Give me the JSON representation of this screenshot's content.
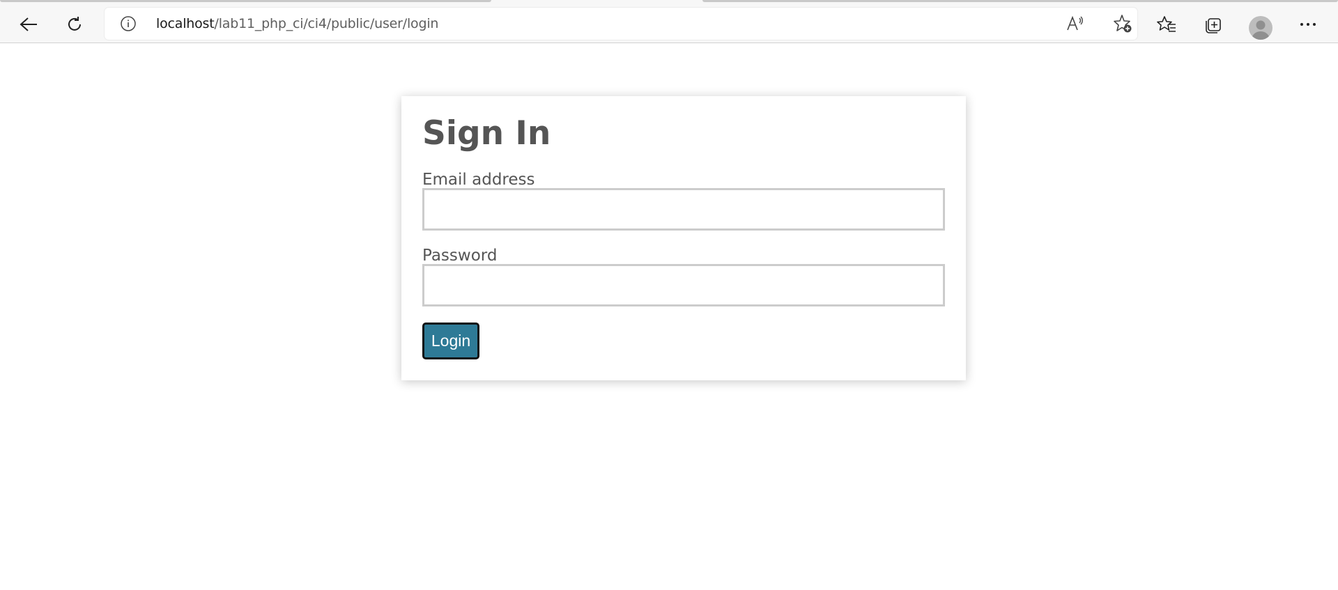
{
  "browser": {
    "address": {
      "host": "localhost",
      "path": "/lab11_php_ci/ci4/public/user/login"
    },
    "icons": {
      "back": "back-arrow-icon",
      "refresh": "refresh-icon",
      "site_info": "info-icon",
      "read_aloud": "read-aloud-icon",
      "add_favorite": "add-favorite-icon",
      "favorites": "favorites-icon",
      "collections": "collections-icon",
      "profile": "profile-avatar",
      "menu": "more-menu-icon"
    }
  },
  "login": {
    "title": "Sign In",
    "email_label": "Email address",
    "email_value": "",
    "password_label": "Password",
    "password_value": "",
    "submit_label": "Login"
  },
  "colors": {
    "button": "#2e7a96",
    "text": "#555555",
    "input_border": "#cccccc"
  }
}
